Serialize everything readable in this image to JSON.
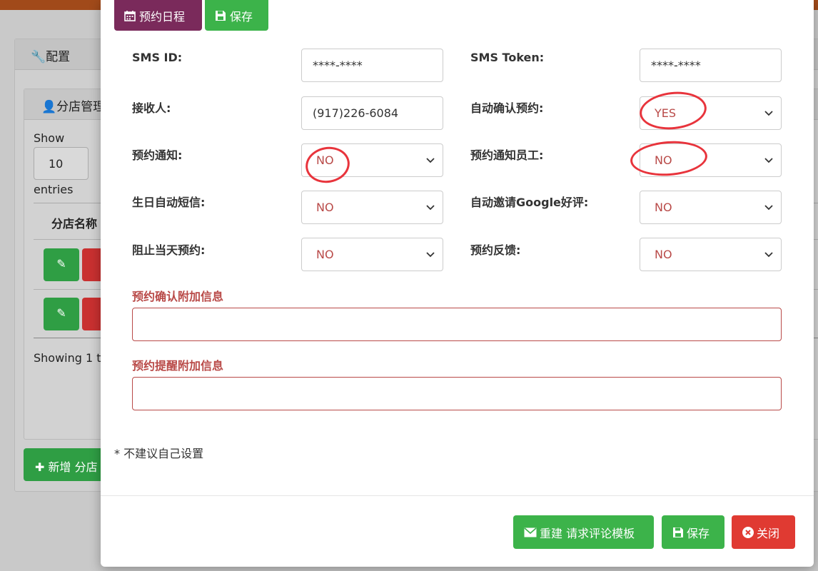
{
  "background": {
    "panel_title": "配置",
    "sub_title": "分店管理",
    "show_label": "Show",
    "page_size": "10",
    "entries_label": "entries",
    "col_branch_name": "分店名称",
    "showing_text": "Showing 1 t",
    "add_button": "新增 分店"
  },
  "modal": {
    "toolbar": {
      "schedule_label": "预约日程",
      "save_label": "保存"
    },
    "fields": {
      "sms_id_label": "SMS ID:",
      "sms_id_value": "****-****",
      "sms_token_label": "SMS Token:",
      "sms_token_value": "****-****",
      "recipient_label": "接收人:",
      "recipient_value": "(917)226-6084",
      "auto_confirm_label": "自动确认预约:",
      "auto_confirm_value": "YES",
      "notify_label": "预约通知:",
      "notify_value": "NO",
      "notify_staff_label": "预约通知员工:",
      "notify_staff_value": "NO",
      "birthday_sms_label": "生日自动短信:",
      "birthday_sms_value": "NO",
      "google_review_label": "自动邀请Google好评:",
      "google_review_value": "NO",
      "block_sameday_label": "阻止当天预约:",
      "block_sameday_value": "NO",
      "feedback_label": "预约反馈:",
      "feedback_value": "NO"
    },
    "confirm_extra_label": "预约确认附加信息",
    "reminder_extra_label": "预约提醒附加信息",
    "note": "* 不建议自己设置",
    "footer": {
      "rebuild_label": "重建 请求评论模板",
      "save_label": "保存",
      "close_label": "关闭"
    }
  },
  "colors": {
    "purple": "#7a2a5b",
    "green": "#3cb34a",
    "red": "#e03a32",
    "select_text": "#b94a48",
    "annotation": "#e8343c"
  }
}
